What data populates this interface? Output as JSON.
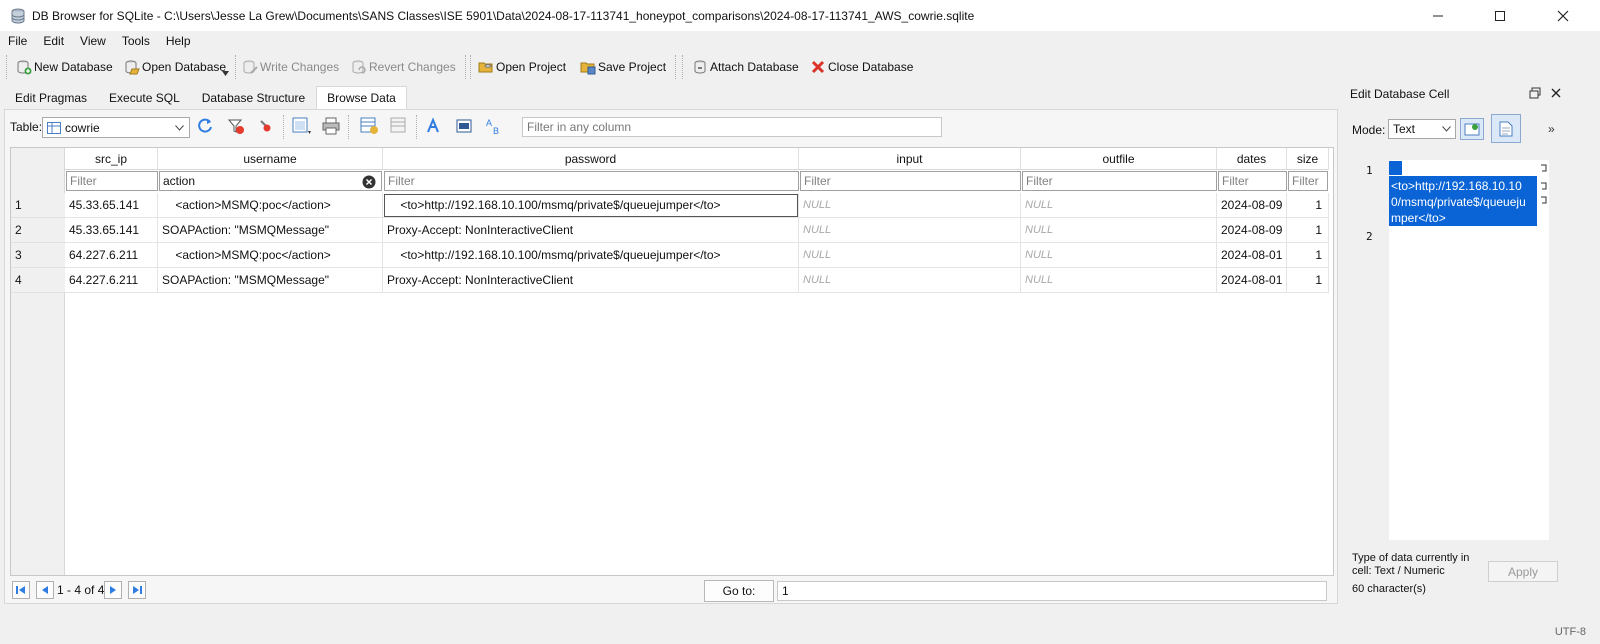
{
  "window": {
    "title": "DB Browser for SQLite - C:\\Users\\Jesse La Grew\\Documents\\SANS Classes\\ISE 5901\\Data\\2024-08-17-113741_honeypot_comparisons\\2024-08-17-113741_AWS_cowrie.sqlite"
  },
  "menu": [
    "File",
    "Edit",
    "View",
    "Tools",
    "Help"
  ],
  "toolbar": {
    "new_database": "New Database",
    "open_database": "Open Database",
    "write_changes": "Write Changes",
    "revert_changes": "Revert Changes",
    "open_project": "Open Project",
    "save_project": "Save Project",
    "attach_database": "Attach Database",
    "close_database": "Close Database"
  },
  "tabs": [
    "Edit Pragmas",
    "Execute SQL",
    "Database Structure",
    "Browse Data"
  ],
  "browse": {
    "table_label": "Table:",
    "table_value": "cowrie",
    "filter_any_placeholder": "Filter in any column"
  },
  "grid": {
    "columns": [
      "src_ip",
      "username",
      "password",
      "input",
      "outfile",
      "dates",
      "size"
    ],
    "filter_placeholder": "Filter",
    "username_filter_value": "action",
    "rows": [
      {
        "num": "1",
        "src_ip": "45.33.65.141",
        "username": "    <action>MSMQ:poc</action>",
        "password": "    <to>http://192.168.10.100/msmq/private$/queuejumper</to>",
        "input": "NULL",
        "outfile": "NULL",
        "dates": "2024-08-09",
        "size": "1"
      },
      {
        "num": "2",
        "src_ip": "45.33.65.141",
        "username": "SOAPAction: \"MSMQMessage\"",
        "password": "Proxy-Accept: NonInteractiveClient",
        "input": "NULL",
        "outfile": "NULL",
        "dates": "2024-08-09",
        "size": "1"
      },
      {
        "num": "3",
        "src_ip": "64.227.6.211",
        "username": "    <action>MSMQ:poc</action>",
        "password": "    <to>http://192.168.10.100/msmq/private$/queuejumper</to>",
        "input": "NULL",
        "outfile": "NULL",
        "dates": "2024-08-01",
        "size": "1"
      },
      {
        "num": "4",
        "src_ip": "64.227.6.211",
        "username": "SOAPAction: \"MSMQMessage\"",
        "password": "Proxy-Accept: NonInteractiveClient",
        "input": "NULL",
        "outfile": "NULL",
        "dates": "2024-08-01",
        "size": "1"
      }
    ]
  },
  "nav": {
    "range": "1 - 4 of 4",
    "goto_label": "Go to:",
    "goto_value": "1"
  },
  "edit_cell": {
    "title": "Edit Database Cell",
    "mode_label": "Mode:",
    "mode_value": "Text",
    "line_numbers": [
      "1",
      "2"
    ],
    "content_lines": [
      "<to>http://192.168.10.10",
      "0/msmq/private$/queueju",
      "mper</to>"
    ],
    "type_info": "Type of data currently in cell: Text / Numeric",
    "char_count": "60 character(s)",
    "apply_label": "Apply"
  },
  "status": {
    "encoding": "UTF-8"
  },
  "colors": {
    "selection": "#0a64d6",
    "accent_blue": "#2f7de1"
  }
}
